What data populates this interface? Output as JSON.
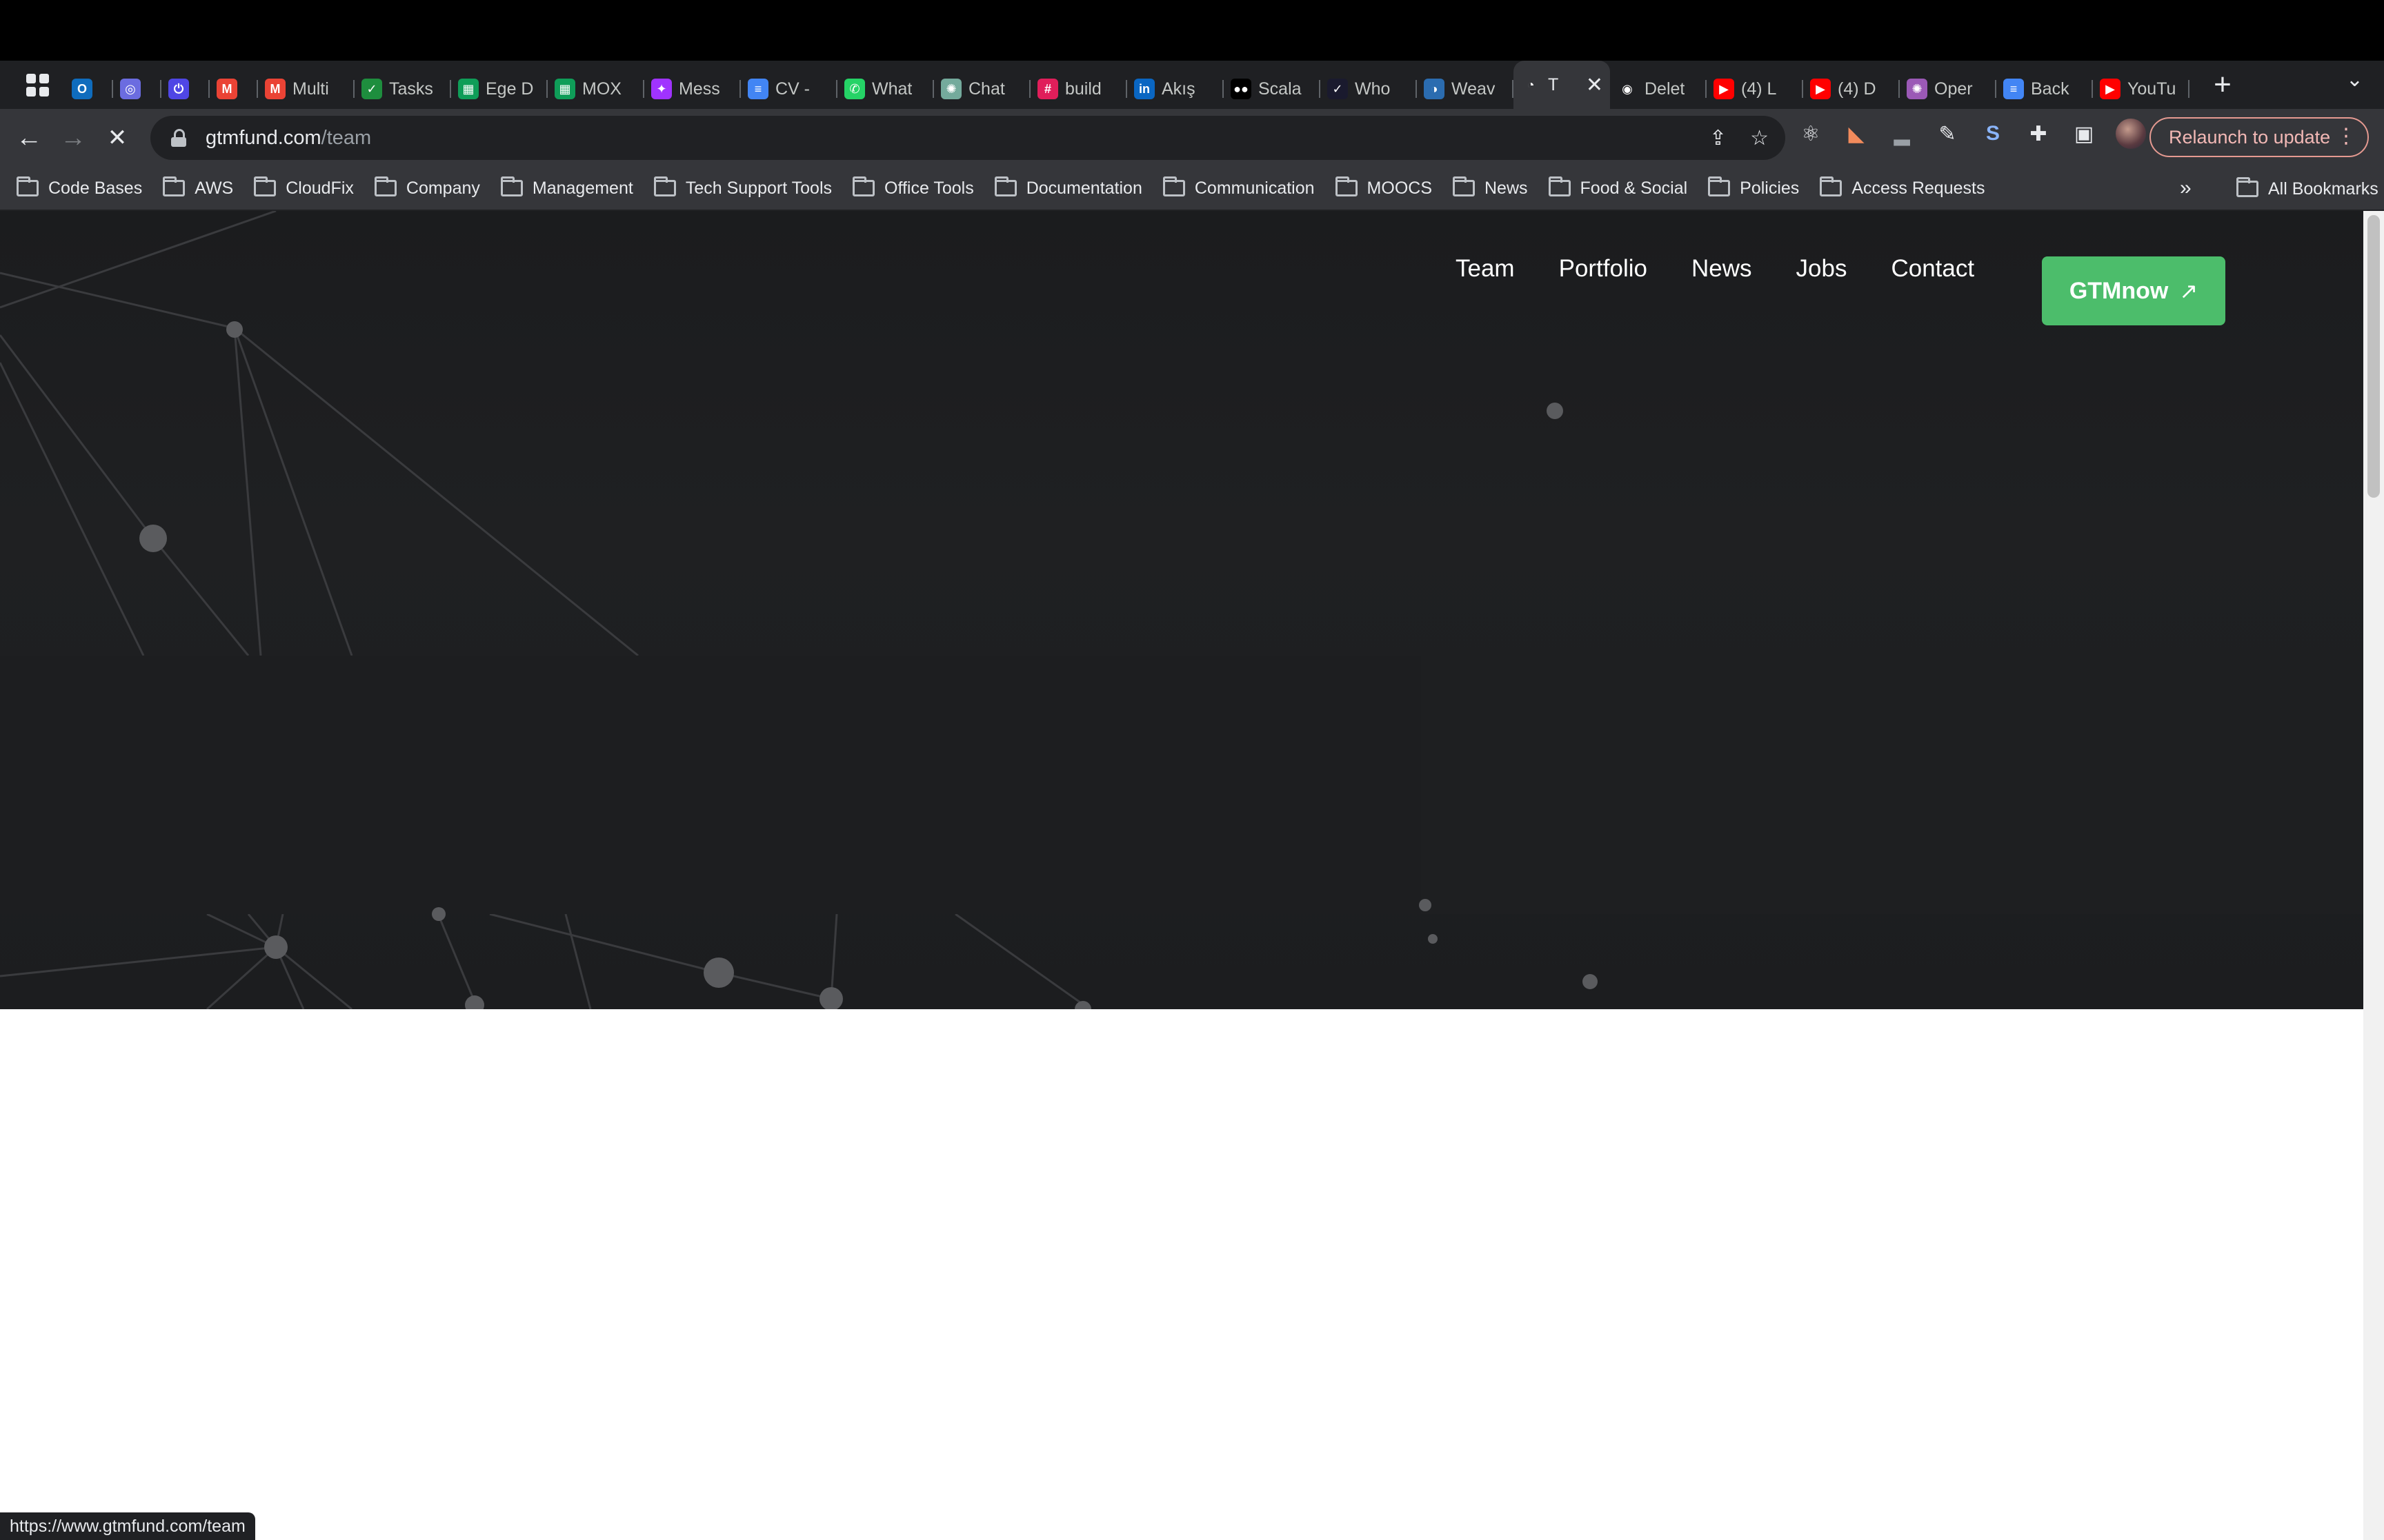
{
  "browser": {
    "tabs": [
      {
        "title": "",
        "icon": "outlook-icon",
        "color": "#0f6cbd"
      },
      {
        "title": "",
        "icon": "circle-logo-icon",
        "color": "#6b6ce0"
      },
      {
        "title": "",
        "icon": "power-icon",
        "color": "#4f46e5"
      },
      {
        "title": "",
        "icon": "gmail-icon",
        "color": "#ea4335"
      },
      {
        "title": "Multi",
        "icon": "gmail-icon",
        "color": "#ea4335"
      },
      {
        "title": "Tasks",
        "icon": "tasks-icon",
        "color": "#1e8e3e"
      },
      {
        "title": "Ege D",
        "icon": "sheets-icon",
        "color": "#0f9d58"
      },
      {
        "title": "MOX",
        "icon": "sheets-icon",
        "color": "#0f9d58"
      },
      {
        "title": "Mess",
        "icon": "messenger-icon",
        "color": "#a033ff"
      },
      {
        "title": "CV -",
        "icon": "docs-icon",
        "color": "#4285f4"
      },
      {
        "title": "What",
        "icon": "whatsapp-icon",
        "color": "#25d366"
      },
      {
        "title": "Chat",
        "icon": "chatgpt-icon",
        "color": "#74aa9c"
      },
      {
        "title": "build",
        "icon": "slack-icon",
        "color": "#e01e5a"
      },
      {
        "title": "Akış",
        "icon": "linkedin-icon",
        "color": "#0a66c2"
      },
      {
        "title": "Scala",
        "icon": "medium-icon",
        "color": "#000000"
      },
      {
        "title": "Who",
        "icon": "wellfound-icon",
        "color": "#1a1a2e"
      },
      {
        "title": "Weav",
        "icon": "weave-icon",
        "color": "#2b6cb0"
      },
      {
        "title": "T",
        "icon": "gtm-icon",
        "color": "#35363a",
        "active": true
      },
      {
        "title": "Delet",
        "icon": "github-icon",
        "color": "#ffffff"
      },
      {
        "title": "(4) L",
        "icon": "youtube-icon",
        "color": "#ff0000"
      },
      {
        "title": "(4) D",
        "icon": "youtube-icon",
        "color": "#ff0000"
      },
      {
        "title": "Oper",
        "icon": "openai-icon",
        "color": "#9b59b6"
      },
      {
        "title": "Back",
        "icon": "docs-icon",
        "color": "#4285f4"
      },
      {
        "title": "YouTu",
        "icon": "youtube-icon",
        "color": "#ff0000"
      }
    ],
    "close_glyph": "✕",
    "new_tab_glyph": "+",
    "url_domain": "gtmfund.com",
    "url_path": "/team",
    "relaunch_label": "Relaunch to update",
    "bookmarks": [
      "Code Bases",
      "AWS",
      "CloudFix",
      "Company",
      "Management",
      "Tech Support Tools",
      "Office Tools",
      "Documentation",
      "Communication",
      "MOOCS",
      "News",
      "Food & Social",
      "Policies",
      "Access Requests"
    ],
    "bookmarks_overflow": "»",
    "all_bookmarks": "All Bookmarks",
    "status_url": "https://www.gtmfund.com/team"
  },
  "site": {
    "nav": [
      "Team",
      "Portfolio",
      "News",
      "Jobs",
      "Contact"
    ],
    "cta_label": "GTMnow",
    "cta_arrow": "↗",
    "cta_color": "#4cbd6b"
  }
}
